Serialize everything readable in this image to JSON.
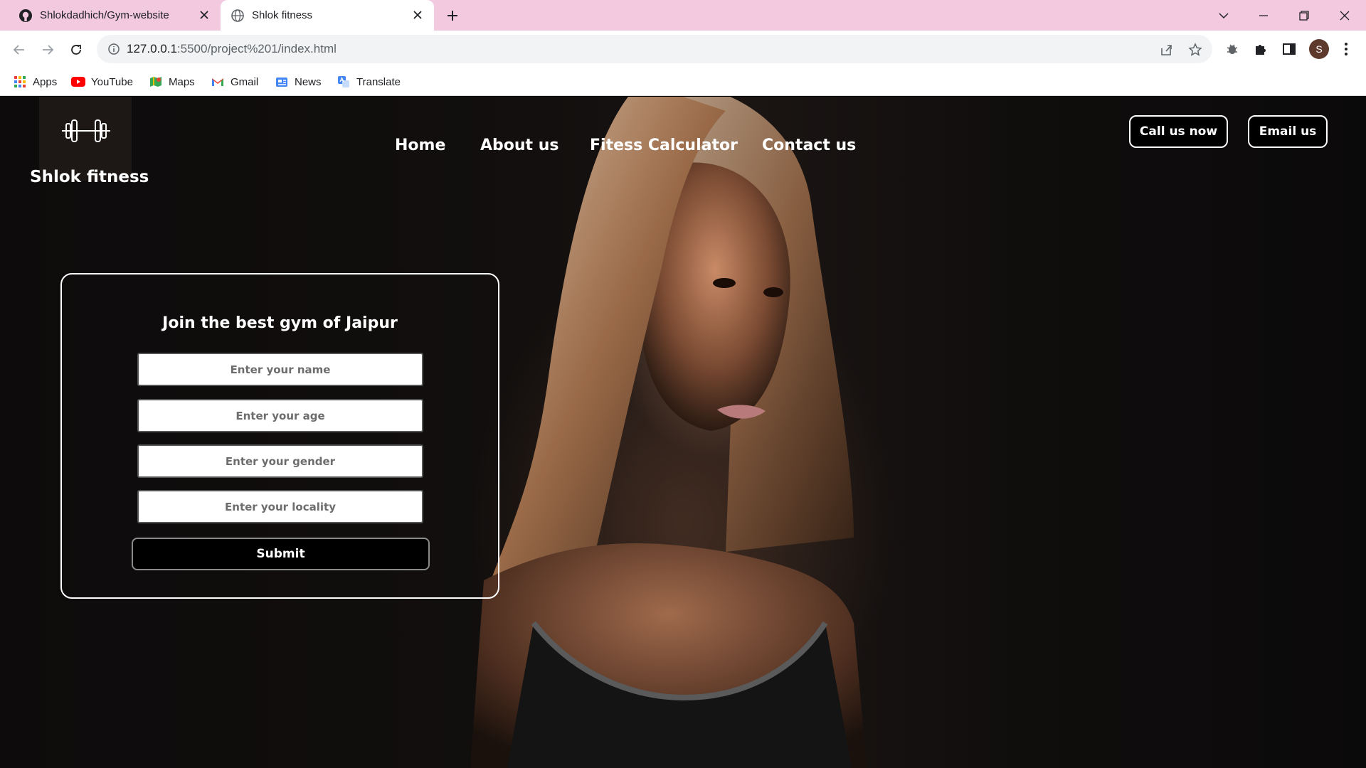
{
  "browser": {
    "tabs": [
      {
        "title": "Shlokdadhich/Gym-website",
        "icon": "github-icon"
      },
      {
        "title": "Shlok fitness",
        "icon": "globe-icon"
      }
    ],
    "url": {
      "host": "127.0.0.1",
      "path": ":5500/project%201/index.html"
    },
    "profile_initial": "S",
    "bookmarks": [
      {
        "label": "Apps",
        "icon": "apps-grid-icon"
      },
      {
        "label": "YouTube",
        "icon": "youtube-icon"
      },
      {
        "label": "Maps",
        "icon": "maps-icon"
      },
      {
        "label": "Gmail",
        "icon": "gmail-icon"
      },
      {
        "label": "News",
        "icon": "news-icon"
      },
      {
        "label": "Translate",
        "icon": "translate-icon"
      }
    ]
  },
  "site": {
    "brand": "Shlok fitness",
    "nav": [
      "Home",
      "About us",
      "Fitess Calculator",
      "Contact us"
    ],
    "cta": {
      "call": "Call us now",
      "email": "Email us"
    },
    "form": {
      "title": "Join the best gym of Jaipur",
      "fields": [
        {
          "placeholder": "Enter your name"
        },
        {
          "placeholder": "Enter your age"
        },
        {
          "placeholder": "Enter your gender"
        },
        {
          "placeholder": "Enter your locality"
        }
      ],
      "submit": "Submit"
    }
  },
  "colors": {
    "tabbar": "#f3c9df",
    "page_bg": "#000000",
    "text": "#ffffff"
  }
}
